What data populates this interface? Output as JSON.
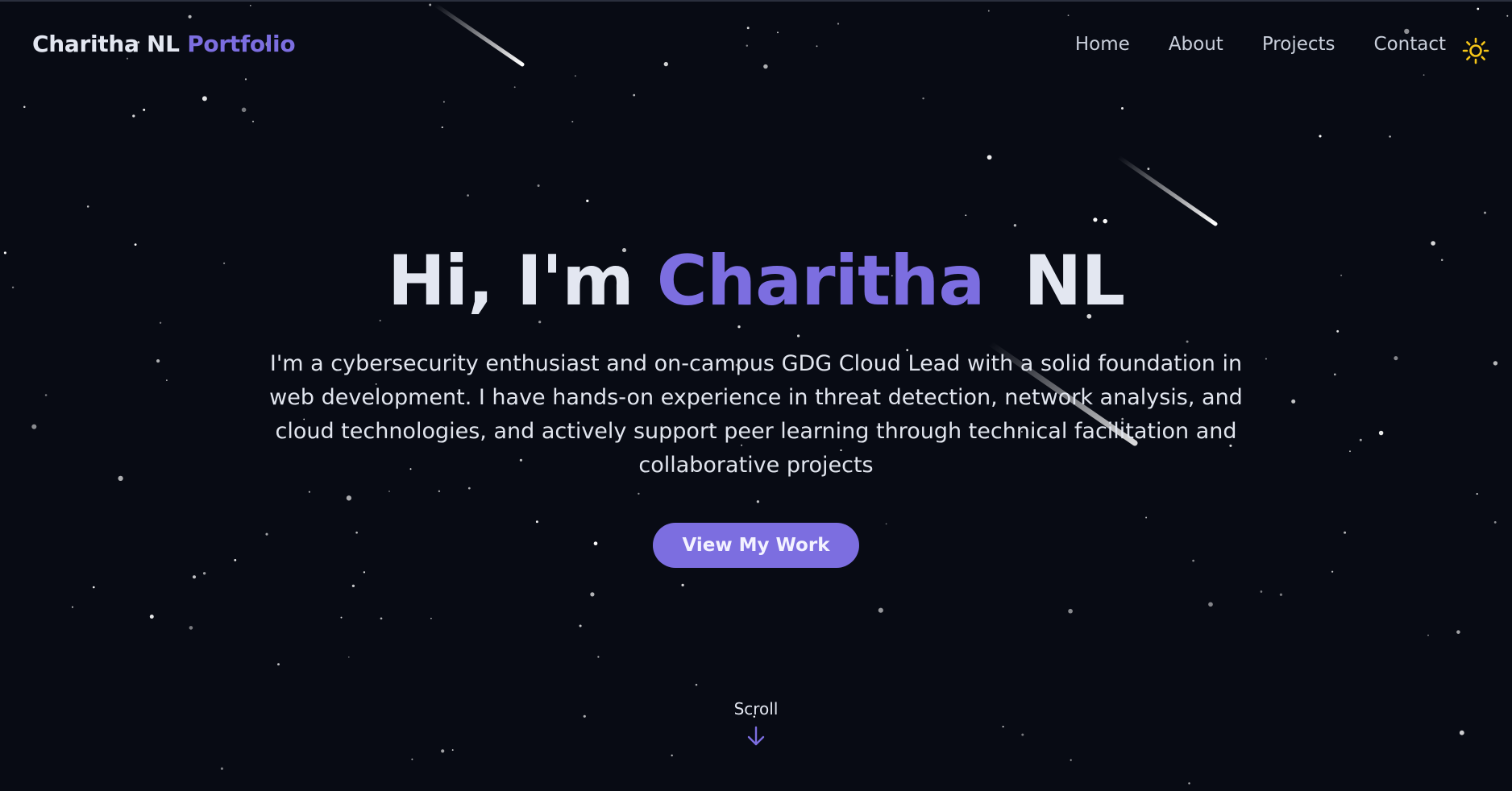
{
  "nav": {
    "brand_name": "Charitha NL",
    "brand_suffix": "Portfolio",
    "links": [
      "Home",
      "About",
      "Projects",
      "Contact"
    ],
    "theme_icon": "sun-icon"
  },
  "hero": {
    "greeting": "Hi, I'm",
    "first_name": "Charitha",
    "last_name": "NL",
    "bio": "I'm a cybersecurity enthusiast and on-campus GDG Cloud Lead with a solid foundation in web development. I have hands-on experience in threat detection, network analysis, and cloud technologies, and actively support peer learning through technical facilitation and collaborative projects",
    "cta_label": "View My Work"
  },
  "scroll": {
    "label": "Scroll",
    "icon": "arrow-down-icon"
  },
  "colors": {
    "background": "#080b14",
    "accent": "#7c6ee0",
    "text": "#e3e7f1",
    "sun": "#f5c518"
  }
}
